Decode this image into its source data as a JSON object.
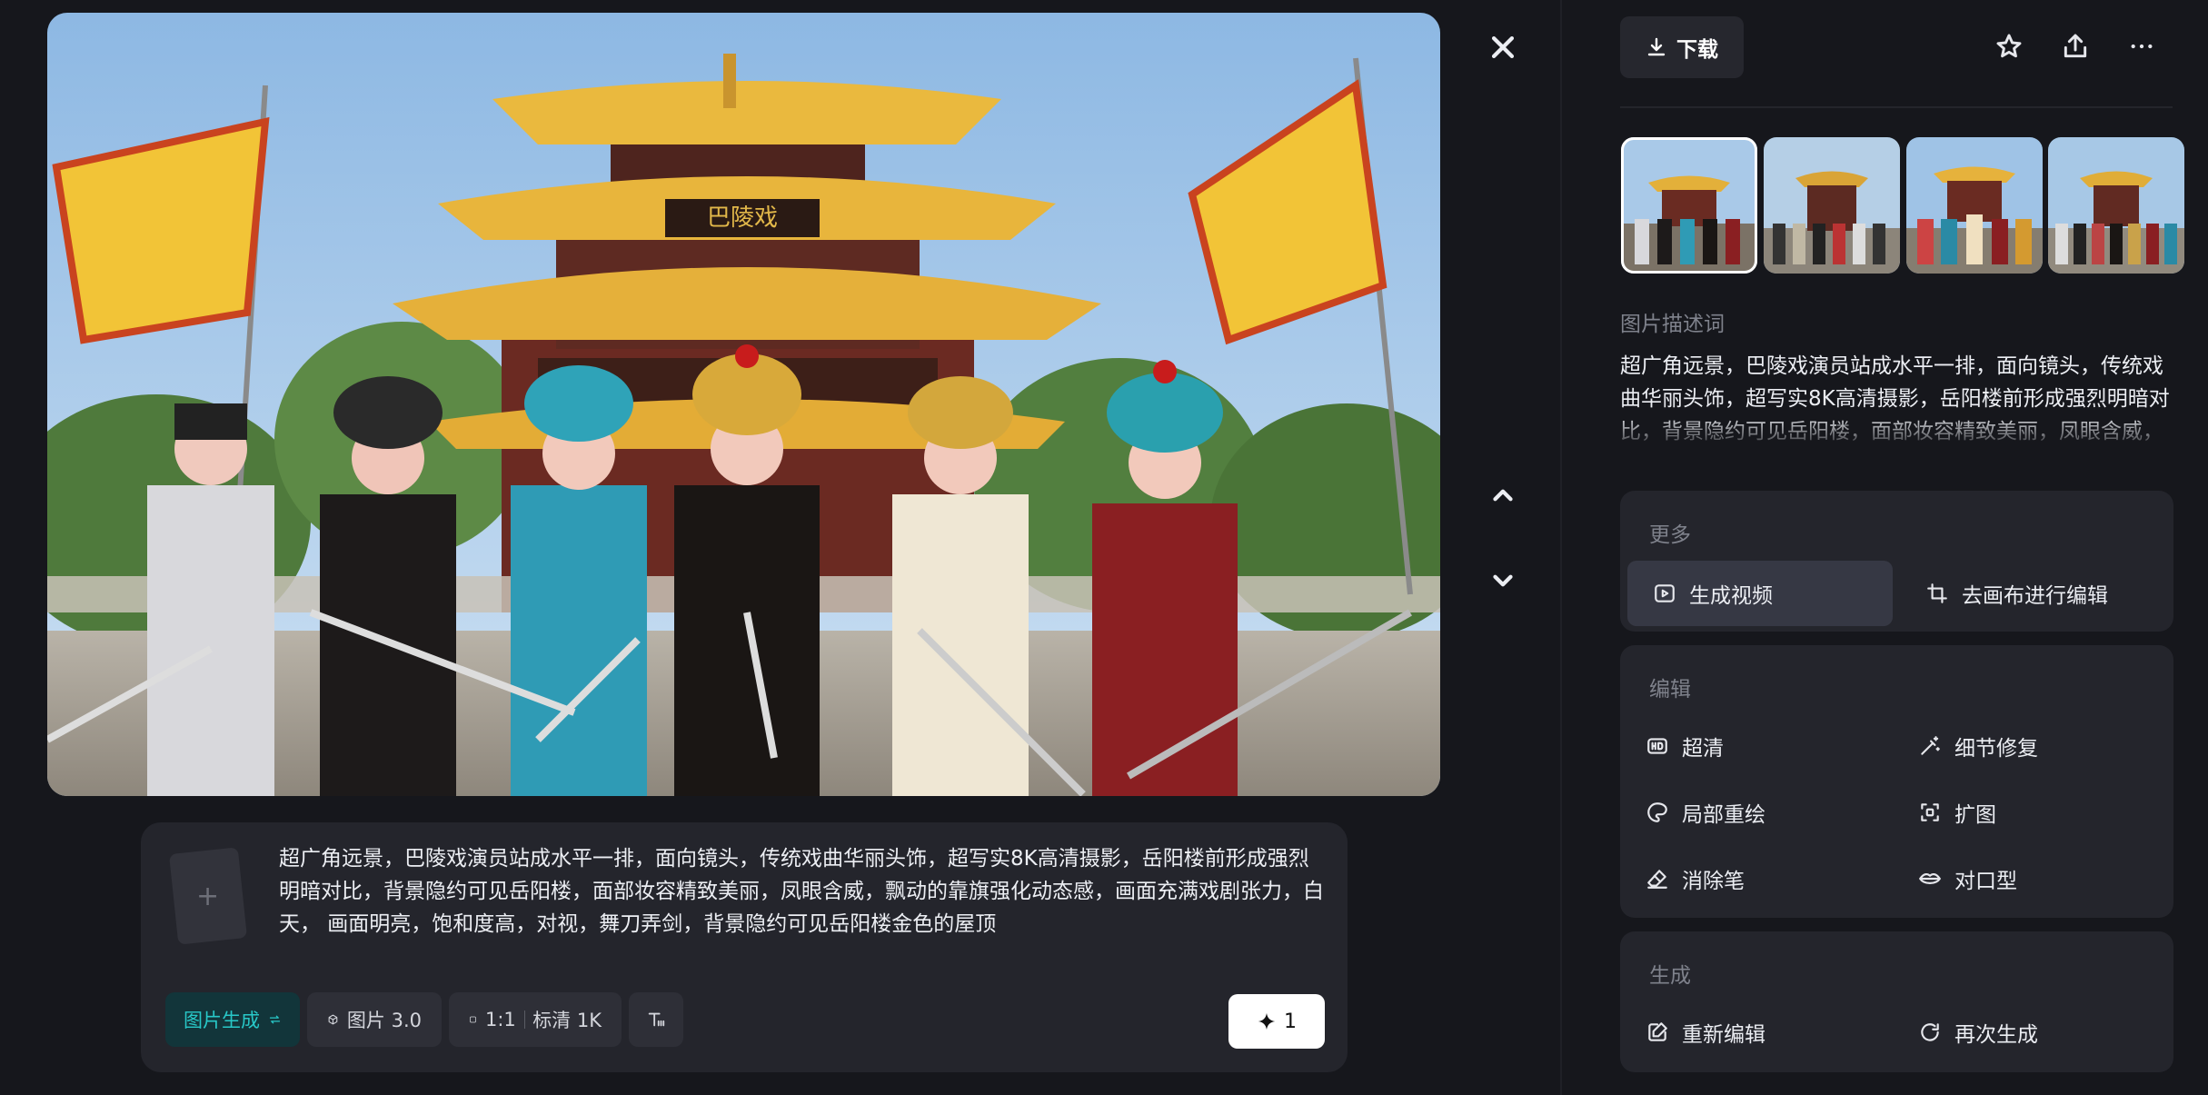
{
  "viewer": {
    "close_icon": "close-icon",
    "prev_icon": "chevron-up-icon",
    "next_icon": "chevron-down-icon"
  },
  "main_image": {
    "signboard_text": "巴陵戏"
  },
  "composer": {
    "prompt": "超广角远景，巴陵戏演员站成水平一排，面向镜头，传统戏曲华丽头饰，超写实8K高清摄影，岳阳楼前形成强烈明暗对比，背景隐约可见岳阳楼，面部妆容精致美丽，凤眼含威，飘动的靠旗强化动态感，画面充满戏剧张力，白天，  画面明亮，饱和度高，对视，舞刀弄剑，背景隐约可见岳阳楼金色的屋顶",
    "ref_plus": "+",
    "mode_label": "图片生成",
    "model_label": "图片 3.0",
    "ratio_label": "1:1",
    "quality_label": "标清 1K",
    "generate_count": "1"
  },
  "panel": {
    "download_label": "下载",
    "desc_label": "图片描述词",
    "desc_text": "超广角远景，巴陵戏演员站成水平一排，面向镜头，传统戏曲华丽头饰，超写实8K高清摄影，岳阳楼前形成强烈明暗对比，背景隐约可见岳阳楼，面部妆容精致美丽，凤眼含威，",
    "more": {
      "title": "更多",
      "items": [
        "生成视频",
        "去画布进行编辑"
      ]
    },
    "edit": {
      "title": "编辑",
      "items": [
        "超清",
        "细节修复",
        "局部重绘",
        "扩图",
        "消除笔",
        "对口型"
      ]
    },
    "generate": {
      "title": "生成",
      "items": [
        "重新编辑",
        "再次生成"
      ]
    }
  },
  "colors": {
    "background": "#16171c",
    "card": "#24252c",
    "accent_teal": "#28c8c8",
    "selected_item": "#363844"
  }
}
